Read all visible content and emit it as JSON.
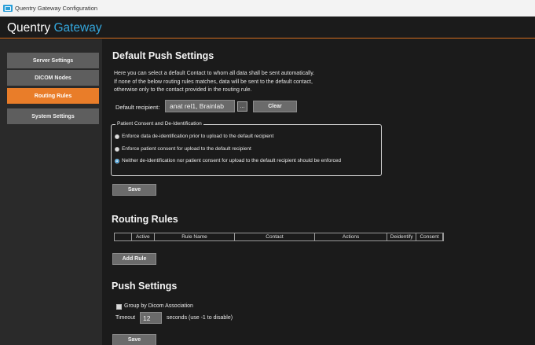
{
  "window": {
    "title": "Quentry Gateway Configuration",
    "icon": "app-window-icon"
  },
  "header": {
    "brand_main": "Quentry",
    "brand_accent": "Gateway"
  },
  "sidebar": {
    "items": [
      {
        "label": "Server Settings",
        "active": false
      },
      {
        "label": "DICOM Nodes",
        "active": false
      },
      {
        "label": "Routing Rules",
        "active": true
      },
      {
        "label": "System Settings",
        "active": false
      }
    ]
  },
  "default_push": {
    "heading": "Default Push Settings",
    "description_lines": [
      "Here you can select a default Contact to whom all data shall be sent automatically.",
      "If none of the below routing rules matches, data will be sent to the default contact,",
      "otherwise only to the contact provided in the routing rule."
    ],
    "recipient_label": "Default recipient:",
    "recipient_value": "anat rel1, Brainlab",
    "browse_label": "...",
    "clear_label": "Clear",
    "consent_group": {
      "legend": "Patient Consent and De-Identification",
      "options": [
        {
          "label": "Enforce data de-identification prior to upload to the default recipient",
          "checked": false
        },
        {
          "label": "Enforce patient consent for upload to the default recipient",
          "checked": false
        },
        {
          "label": "Neither de-identification nor patient consent for upload to the default recipient should be enforced",
          "checked": true
        }
      ]
    },
    "save_label": "Save"
  },
  "routing_rules": {
    "heading": "Routing Rules",
    "columns": [
      "Active",
      "Rule Name",
      "Contact",
      "Actions",
      "Deidentify",
      "Consent",
      ""
    ],
    "add_rule_label": "Add Rule"
  },
  "push_settings": {
    "heading": "Push Settings",
    "group_by_label": "Group by Dicom Association",
    "group_by_checked": false,
    "timeout_label": "Timeout",
    "timeout_value": "12",
    "timeout_hint": "seconds (use -1 to disable)",
    "save_label": "Save"
  },
  "colors": {
    "accent_orange": "#e97d29",
    "accent_blue": "#34a7dd",
    "background": "#1b1b1b"
  }
}
